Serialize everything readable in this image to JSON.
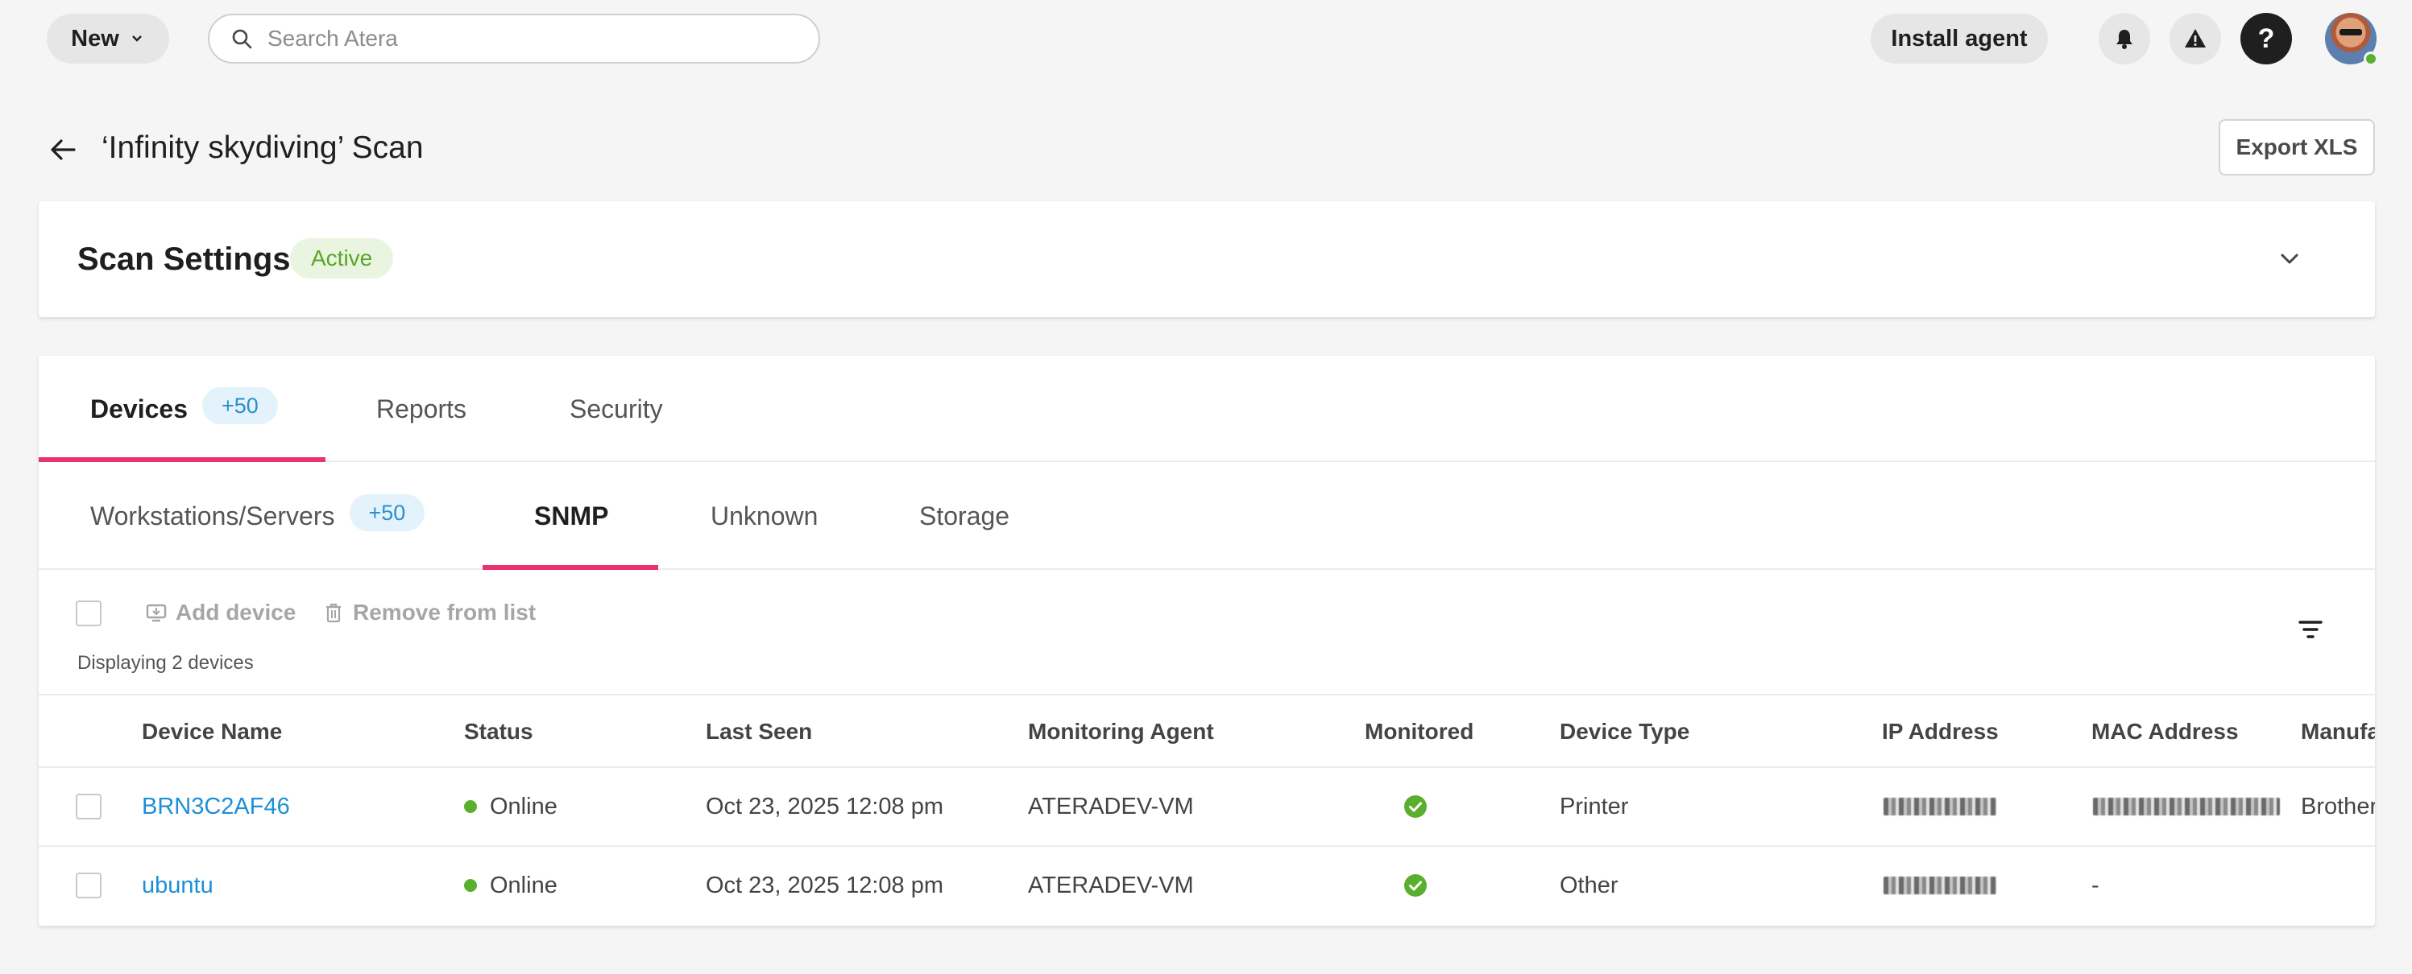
{
  "topbar": {
    "new_label": "New",
    "search_placeholder": "Search Atera",
    "install_label": "Install agent",
    "help_label": "?"
  },
  "page": {
    "title": "‘Infinity skydiving’ Scan",
    "export_label": "Export XLS"
  },
  "scan_settings": {
    "title": "Scan Settings",
    "status": "Active"
  },
  "tabs": [
    {
      "label": "Devices",
      "count": "+50"
    },
    {
      "label": "Reports"
    },
    {
      "label": "Security"
    }
  ],
  "subtabs": [
    {
      "label": "Workstations/Servers",
      "count": "+50"
    },
    {
      "label": "SNMP"
    },
    {
      "label": "Unknown"
    },
    {
      "label": "Storage"
    }
  ],
  "toolbar": {
    "add_label": "Add device",
    "remove_label": "Remove from list",
    "displaying": "Displaying 2 devices"
  },
  "table": {
    "columns": [
      "Device Name",
      "Status",
      "Last Seen",
      "Monitoring Agent",
      "Monitored",
      "Device Type",
      "IP Address",
      "MAC Address",
      "Manufa"
    ],
    "rows": [
      {
        "name": "BRN3C2AF46",
        "status": "Online",
        "last_seen": "Oct 23, 2025 12:08 pm",
        "agent": "ATERADEV-VM",
        "type": "Printer",
        "mac": "",
        "manufacturer": "Brother"
      },
      {
        "name": "ubuntu",
        "status": "Online",
        "last_seen": "Oct 23, 2025 12:08 pm",
        "agent": "ATERADEV-VM",
        "type": "Other",
        "mac": "-",
        "manufacturer": ""
      }
    ]
  },
  "colors": {
    "accent_underline": "#e8336f",
    "link": "#1e8fd6",
    "online": "#5ab02e",
    "badge_bg": "#e3f2fb",
    "badge_text": "#2b8fcf"
  },
  "icons": [
    "chevron-down-icon",
    "search-icon",
    "bell-icon",
    "warning-icon",
    "help-icon",
    "back-arrow-icon",
    "add-device-icon",
    "trash-icon",
    "filter-icon",
    "check-circle-icon"
  ]
}
